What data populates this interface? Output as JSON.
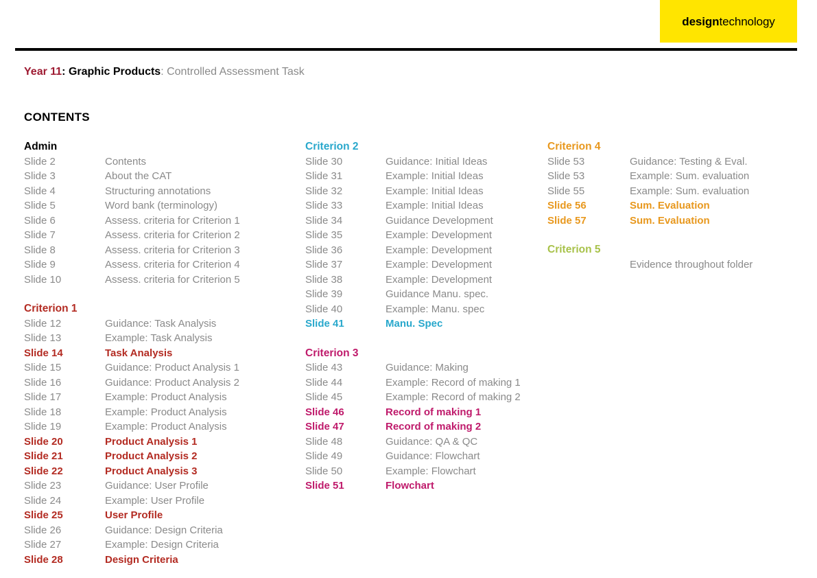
{
  "logo": {
    "bold_part": "design",
    "light_part": "technology",
    "background_color": "#ffe500"
  },
  "header": {
    "year": "Year 11",
    "year_separator": ": ",
    "subject": "Graphic Products",
    "subject_separator": ": ",
    "task": "Controlled Assessment Task",
    "rule_color": "#000000"
  },
  "contents_heading": "CONTENTS",
  "colors": {
    "admin": "#000000",
    "criterion1": "#b32b22",
    "criterion2": "#29a8cc",
    "criterion3": "#bf1a6b",
    "criterion4": "#e8981e",
    "criterion5": "#a8c24a",
    "normal_text": "#8a8a8a",
    "year_red": "#9e1b32"
  },
  "columns": [
    {
      "id": "column-1",
      "sections": [
        {
          "title": "Admin",
          "color": "#000000",
          "rows": [
            {
              "number": "Slide 2",
              "description": "Contents",
              "highlight": false
            },
            {
              "number": "Slide 3",
              "description": "About the CAT",
              "highlight": false
            },
            {
              "number": "Slide 4",
              "description": "Structuring annotations",
              "highlight": false
            },
            {
              "number": "Slide 5",
              "description": "Word bank (terminology)",
              "highlight": false
            },
            {
              "number": "Slide 6",
              "description": "Assess. criteria for Criterion 1",
              "highlight": false
            },
            {
              "number": "Slide 7",
              "description": "Assess. criteria for Criterion 2",
              "highlight": false
            },
            {
              "number": "Slide 8",
              "description": "Assess. criteria for Criterion 3",
              "highlight": false
            },
            {
              "number": "Slide 9",
              "description": "Assess. criteria for Criterion 4",
              "highlight": false
            },
            {
              "number": "Slide 10",
              "description": "Assess. criteria for Criterion 5",
              "highlight": false
            }
          ]
        },
        {
          "title": "Criterion 1",
          "color": "#b32b22",
          "rows": [
            {
              "number": "Slide 12",
              "description": "Guidance: Task Analysis",
              "highlight": false
            },
            {
              "number": "Slide 13",
              "description": "Example: Task Analysis",
              "highlight": false
            },
            {
              "number": "Slide 14",
              "description": "Task Analysis",
              "highlight": true
            },
            {
              "number": "Slide 15",
              "description": "Guidance: Product Analysis 1",
              "highlight": false
            },
            {
              "number": "Slide 16",
              "description": "Guidance: Product Analysis 2",
              "highlight": false
            },
            {
              "number": "Slide 17",
              "description": "Example: Product Analysis",
              "highlight": false
            },
            {
              "number": "Slide 18",
              "description": "Example: Product Analysis",
              "highlight": false
            },
            {
              "number": "Slide 19",
              "description": "Example: Product Analysis",
              "highlight": false
            },
            {
              "number": "Slide 20",
              "description": "Product Analysis 1",
              "highlight": true
            },
            {
              "number": "Slide 21",
              "description": "Product Analysis 2",
              "highlight": true
            },
            {
              "number": "Slide 22",
              "description": "Product Analysis 3",
              "highlight": true
            },
            {
              "number": "Slide 23",
              "description": "Guidance: User Profile",
              "highlight": false
            },
            {
              "number": "Slide 24",
              "description": "Example: User Profile",
              "highlight": false
            },
            {
              "number": "Slide 25",
              "description": "User Profile",
              "highlight": true
            },
            {
              "number": "Slide 26",
              "description": "Guidance: Design Criteria",
              "highlight": false
            },
            {
              "number": "Slide 27",
              "description": "Example: Design Criteria",
              "highlight": false
            },
            {
              "number": "Slide 28",
              "description": "Design Criteria",
              "highlight": true
            }
          ]
        }
      ]
    },
    {
      "id": "column-2",
      "sections": [
        {
          "title": "Criterion 2",
          "color": "#29a8cc",
          "rows": [
            {
              "number": "Slide 30",
              "description": "Guidance: Initial Ideas",
              "highlight": false
            },
            {
              "number": "Slide 31",
              "description": "Example: Initial Ideas",
              "highlight": false
            },
            {
              "number": "Slide 32",
              "description": "Example: Initial Ideas",
              "highlight": false
            },
            {
              "number": "Slide 33",
              "description": "Example: Initial Ideas",
              "highlight": false
            },
            {
              "number": "Slide 34",
              "description": "Guidance Development",
              "highlight": false
            },
            {
              "number": "Slide 35",
              "description": "Example: Development",
              "highlight": false
            },
            {
              "number": "Slide 36",
              "description": "Example: Development",
              "highlight": false
            },
            {
              "number": "Slide 37",
              "description": "Example: Development",
              "highlight": false
            },
            {
              "number": "Slide 38",
              "description": "Example: Development",
              "highlight": false
            },
            {
              "number": "Slide 39",
              "description": "Guidance Manu. spec.",
              "highlight": false
            },
            {
              "number": "Slide 40",
              "description": "Example: Manu. spec",
              "highlight": false
            },
            {
              "number": "Slide 41",
              "description": "Manu. Spec",
              "highlight": true
            }
          ]
        },
        {
          "title": "Criterion 3",
          "color": "#bf1a6b",
          "rows": [
            {
              "number": "Slide 43",
              "description": "Guidance: Making",
              "highlight": false
            },
            {
              "number": "Slide 44",
              "description": "Example: Record of making 1",
              "highlight": false
            },
            {
              "number": "Slide 45",
              "description": "Example: Record of making 2",
              "highlight": false
            },
            {
              "number": "Slide 46",
              "description": "Record of making 1",
              "highlight": true
            },
            {
              "number": "Slide 47",
              "description": "Record of making 2",
              "highlight": true
            },
            {
              "number": "Slide 48",
              "description": "Guidance: QA & QC",
              "highlight": false
            },
            {
              "number": "Slide 49",
              "description": "Guidance: Flowchart",
              "highlight": false
            },
            {
              "number": "Slide 50",
              "description": "Example: Flowchart",
              "highlight": false
            },
            {
              "number": "Slide 51",
              "description": "Flowchart",
              "highlight": true
            }
          ]
        }
      ]
    },
    {
      "id": "column-3",
      "sections": [
        {
          "title": "Criterion 4",
          "color": "#e8981e",
          "rows": [
            {
              "number": "Slide 53",
              "description": "Guidance: Testing & Eval.",
              "highlight": false
            },
            {
              "number": "Slide 53",
              "description": "Example: Sum. evaluation",
              "highlight": false
            },
            {
              "number": "Slide 55",
              "description": "Example: Sum. evaluation",
              "highlight": false
            },
            {
              "number": "Slide 56",
              "description": "Sum. Evaluation",
              "highlight": true
            },
            {
              "number": "Slide 57",
              "description": "Sum. Evaluation",
              "highlight": true
            }
          ]
        },
        {
          "title": "Criterion 5",
          "color": "#a8c24a",
          "rows": [
            {
              "number": "",
              "description": "Evidence throughout folder",
              "highlight": false
            }
          ]
        }
      ]
    }
  ]
}
